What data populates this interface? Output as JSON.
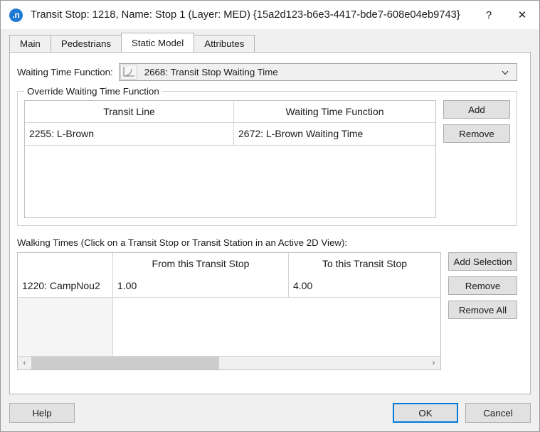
{
  "window": {
    "icon_label": ".n",
    "title": "Transit Stop: 1218, Name: Stop 1 (Layer: MED) {15a2d123-b6e3-4417-bde7-608e04eb9743}",
    "help_button": "?",
    "close_button": "✕"
  },
  "tabs": [
    {
      "label": "Main",
      "active": false
    },
    {
      "label": "Pedestrians",
      "active": false
    },
    {
      "label": "Static Model",
      "active": true
    },
    {
      "label": "Attributes",
      "active": false
    }
  ],
  "static_model": {
    "waiting_time_function": {
      "label": "Waiting Time Function:",
      "value": "2668: Transit Stop Waiting Time",
      "icon": "function-curve-icon",
      "arrow_icon": "chevron-down-icon"
    },
    "override_group": {
      "title": "Override Waiting Time Function",
      "columns": [
        "Transit Line",
        "Waiting Time Function"
      ],
      "rows": [
        {
          "transit_line": "2255: L-Brown",
          "waiting_time_function": "2672: L-Brown Waiting Time"
        }
      ],
      "buttons": [
        "Add",
        "Remove"
      ]
    },
    "walking_times": {
      "label": "Walking Times (Click on a Transit Stop or Transit Station in an Active 2D View):",
      "columns": [
        "",
        "From this Transit Stop",
        "To this Transit Stop"
      ],
      "rows": [
        {
          "stop": "1220: CampNou2",
          "from_this_stop": "1.00",
          "to_this_stop": "4.00"
        }
      ],
      "buttons": [
        "Add Selection",
        "Remove",
        "Remove All"
      ],
      "scrollbar": {
        "left_arrow": "‹",
        "right_arrow": "›"
      }
    }
  },
  "footer": {
    "help": "Help",
    "ok": "OK",
    "cancel": "Cancel"
  },
  "colors": {
    "accent": "#0078d7",
    "icon_blue": "#1f7ad4",
    "dialog_bg": "#f0f0f0",
    "panel_bg": "#ffffff"
  }
}
